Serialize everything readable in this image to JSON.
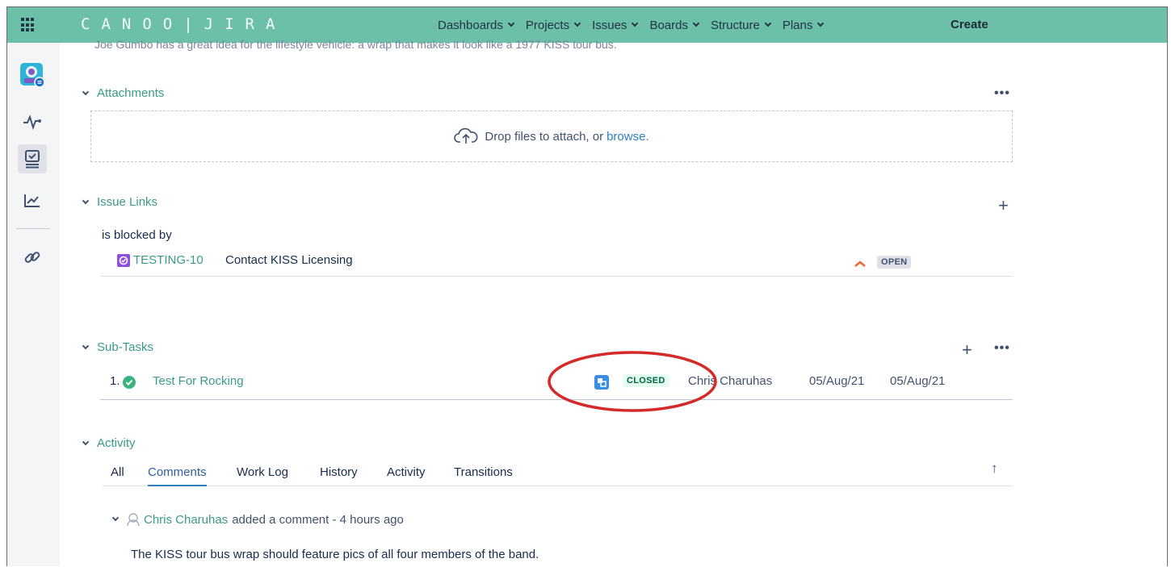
{
  "topbar": {
    "grid_icon": "app-switcher-grid-icon",
    "brand": "CANOO|JIRA",
    "nav": [
      {
        "label": "Dashboards"
      },
      {
        "label": "Projects"
      },
      {
        "label": "Issues"
      },
      {
        "label": "Boards"
      },
      {
        "label": "Structure"
      },
      {
        "label": "Plans"
      }
    ],
    "create_label": "Create"
  },
  "leftbar": {
    "icons": [
      "project-avatar-icon",
      "activity-pulse-icon",
      "board-icon",
      "reports-chart-icon",
      "link-icon"
    ]
  },
  "description_fragment": "Joe Gumbo has a great idea for the lifestyle vehicle: a wrap that makes it look like a 1977 KISS tour bus.",
  "attachments": {
    "heading": "Attachments",
    "more": "•••",
    "drop_text": "Drop files to attach, or",
    "browse": "browse."
  },
  "issue_links": {
    "heading": "Issue Links",
    "add": "+",
    "link_type": "is blocked by",
    "items": [
      {
        "key": "TESTING-10",
        "summary": "Contact KISS Licensing",
        "priority": "high",
        "status": "OPEN"
      }
    ]
  },
  "subtasks": {
    "heading": "Sub-Tasks",
    "add": "+",
    "more": "•••",
    "items": [
      {
        "number": "1.",
        "summary": "Test For Rocking",
        "status": "CLOSED",
        "assignee": "Chris Charuhas",
        "created": "05/Aug/21",
        "updated": "05/Aug/21"
      }
    ]
  },
  "activity": {
    "heading": "Activity",
    "tabs": [
      "All",
      "Comments",
      "Work Log",
      "History",
      "Activity",
      "Transitions"
    ],
    "active_tab": "Comments",
    "sort_icon": "↑",
    "comment": {
      "author": "Chris Charuhas",
      "meta": "added a comment - 4 hours ago",
      "body": "The KISS tour bus wrap should feature pics of all four members of the band."
    }
  },
  "colors": {
    "topbar": "#6cc0aa",
    "link": "#3a9c84",
    "annotation": "#d42a2a"
  }
}
